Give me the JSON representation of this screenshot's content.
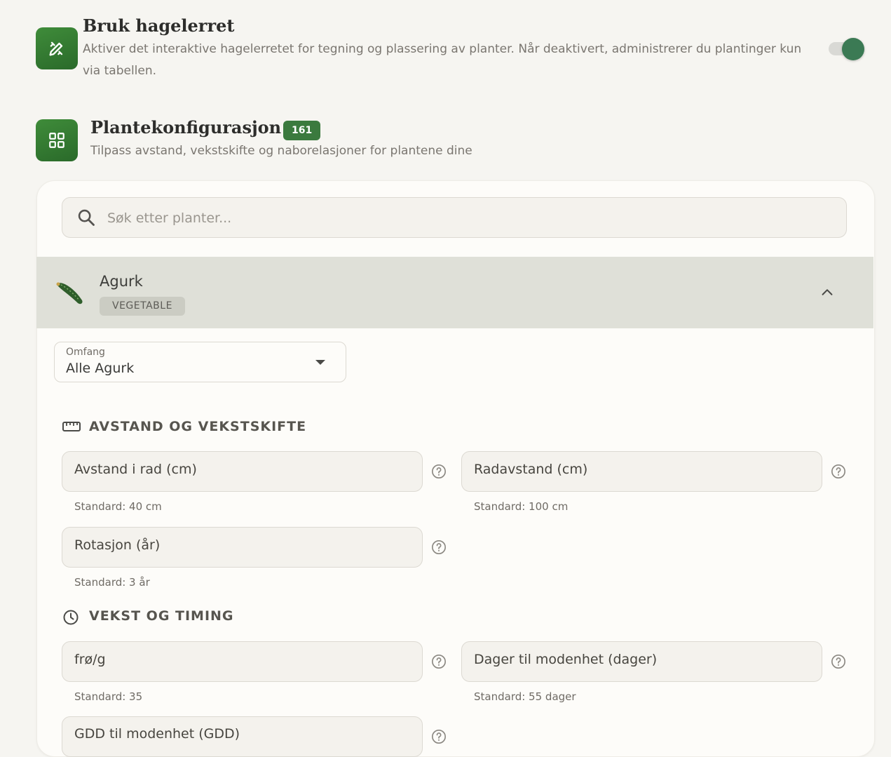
{
  "canvas": {
    "section_one": {
      "title": "Bruk hagelerret",
      "description": "Aktiver det interaktive hagelerretet for tegning og plassering av planter. Når deaktivert, administrerer du plantinger kun via tabellen.",
      "enabled": true
    }
  },
  "plant_config": {
    "title": "Plantekonfigurasjon",
    "count": "161",
    "description": "Tilpass avstand, vekstskifte og naborelasjoner for plantene dine",
    "search": {
      "placeholder": "Søk etter planter..."
    },
    "plant": {
      "name": "Agurk",
      "category": "VEGETABLE"
    },
    "scope": {
      "label": "Omfang",
      "value": "Alle Agurk"
    },
    "groups": {
      "spacing": {
        "title": "AVSTAND OG VEKSTSKIFTE",
        "fields": [
          {
            "label": "Avstand i rad (cm)",
            "help": "Standard: 40 cm"
          },
          {
            "label": "Radavstand (cm)",
            "help": "Standard: 100 cm"
          },
          {
            "label": "Rotasjon (år)",
            "help": "Standard: 3 år"
          }
        ]
      },
      "growth": {
        "title": "VEKST OG TIMING",
        "fields": [
          {
            "label": "frø/g",
            "help": "Standard: 35"
          },
          {
            "label": "Dager til modenhet (dager)",
            "help": "Standard: 55 dager"
          },
          {
            "label": "GDD til modenhet (GDD)",
            "help": ""
          }
        ]
      }
    }
  },
  "colors": {
    "accent": "#3b7a3e",
    "toggle_on": "#3b7a54",
    "plant_header": "#dfe0d8"
  }
}
